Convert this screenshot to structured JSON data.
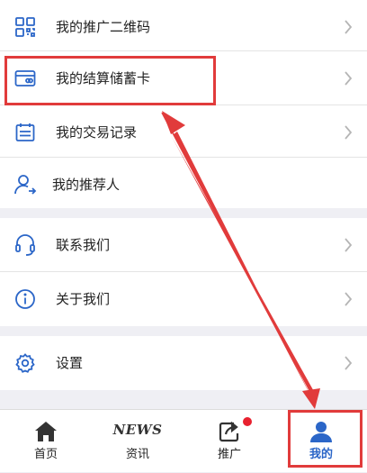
{
  "menu": {
    "group1": [
      {
        "label": "我的推广二维码",
        "icon": "qr-code-icon"
      },
      {
        "label": "我的结算储蓄卡",
        "icon": "bank-card-icon"
      },
      {
        "label": "我的交易记录",
        "icon": "calendar-icon"
      },
      {
        "label": "我的推荐人",
        "icon": "user-referrer-icon"
      }
    ],
    "group2": [
      {
        "label": "联系我们",
        "icon": "headset-icon"
      },
      {
        "label": "关于我们",
        "icon": "info-icon"
      }
    ],
    "group3": [
      {
        "label": "设置",
        "icon": "settings-gear-icon"
      }
    ]
  },
  "tabbar": {
    "tabs": [
      {
        "label": "首页",
        "icon": "home-icon"
      },
      {
        "label": "资讯",
        "icon_text": "NEWS",
        "icon": "news-icon"
      },
      {
        "label": "推广",
        "icon": "share-icon",
        "has_badge": true
      },
      {
        "label": "我的",
        "icon": "user-icon",
        "active": true
      }
    ]
  },
  "colors": {
    "icon_blue": "#2b66c8",
    "annotation_red": "#e13b3b",
    "badge_red": "#e8212f"
  }
}
